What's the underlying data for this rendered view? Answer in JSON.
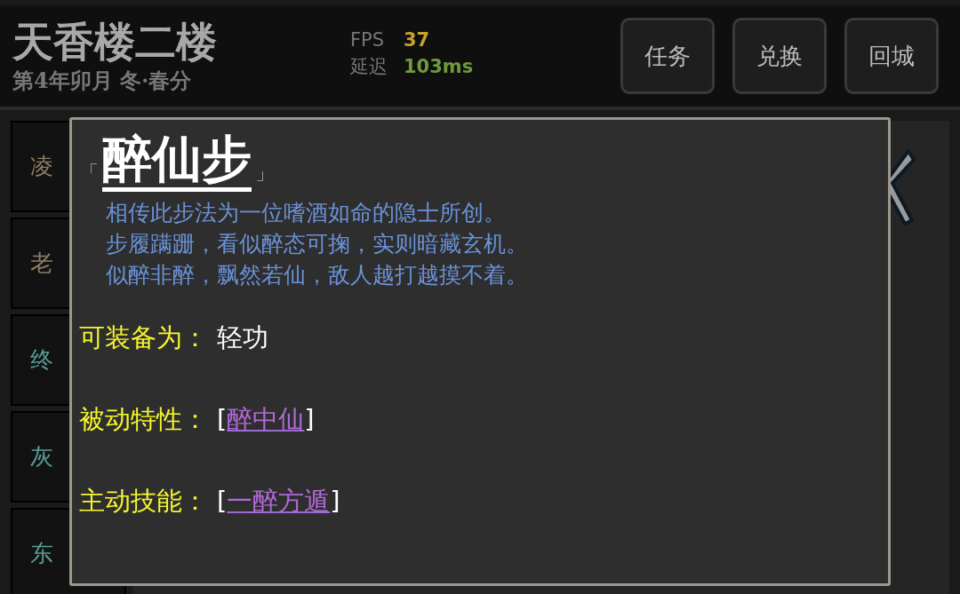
{
  "header": {
    "title": "天香楼二楼",
    "date": "第4年卯月 冬·春分",
    "stats": [
      {
        "label": "FPS",
        "value": "37",
        "color": "#c9a227"
      },
      {
        "label": "延迟",
        "value": "103ms",
        "color": "#6e9a3e"
      }
    ],
    "buttons": [
      "任务",
      "兑换",
      "回城"
    ]
  },
  "sidebar": {
    "items": [
      {
        "label": "凌",
        "color": "#8c7c68"
      },
      {
        "label": "老",
        "color": "#8c7c68"
      },
      {
        "label": "终",
        "color": "#5a9a94"
      },
      {
        "label": "灰",
        "color": "#5a9a94"
      },
      {
        "label": "东",
        "color": "#5a9a94"
      }
    ]
  },
  "tooltip": {
    "open_mark": "「",
    "title": "醉仙步",
    "close_mark": "」",
    "description": [
      "相传此步法为一位嗜酒如命的隐士所创。",
      "步履蹒跚，看似醉态可掬，实则暗藏玄机。",
      "似醉非醉，飘然若仙，敌人越打越摸不着。"
    ],
    "fields": [
      {
        "label": "可装备为：",
        "kind": "text",
        "value": "轻功"
      },
      {
        "label": "被动特性：",
        "kind": "link",
        "open": "[",
        "value": "醉中仙",
        "close": "]"
      },
      {
        "label": "主动技能：",
        "kind": "link",
        "open": "[",
        "value": "一醉方遁",
        "close": "]"
      }
    ]
  }
}
